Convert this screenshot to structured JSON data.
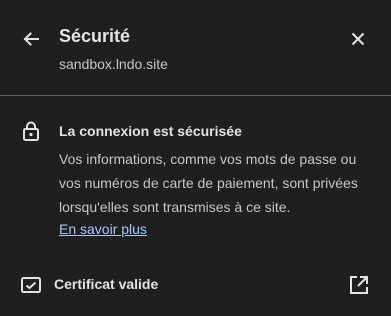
{
  "header": {
    "title": "Sécurité",
    "origin": "sandbox.lndo.site",
    "back_icon": "arrow-back-icon",
    "close_icon": "close-icon"
  },
  "connection": {
    "icon": "lock-icon",
    "title": "La connexion est sécurisée",
    "description": "Vos informations, comme vos mots de passe ou vos numéros de carte de paiement, sont privées lorsqu'elles sont transmises à ce site.",
    "learn_more": "En savoir plus"
  },
  "certificate": {
    "icon": "certificate-icon",
    "label": "Certificat valide",
    "external_icon": "open-in-new-icon"
  },
  "colors": {
    "background": "#1f1f1f",
    "text": "#e3e3e3",
    "secondary_text": "#c4c7c5",
    "link": "#a8c7fa",
    "divider": "#5f6368"
  }
}
